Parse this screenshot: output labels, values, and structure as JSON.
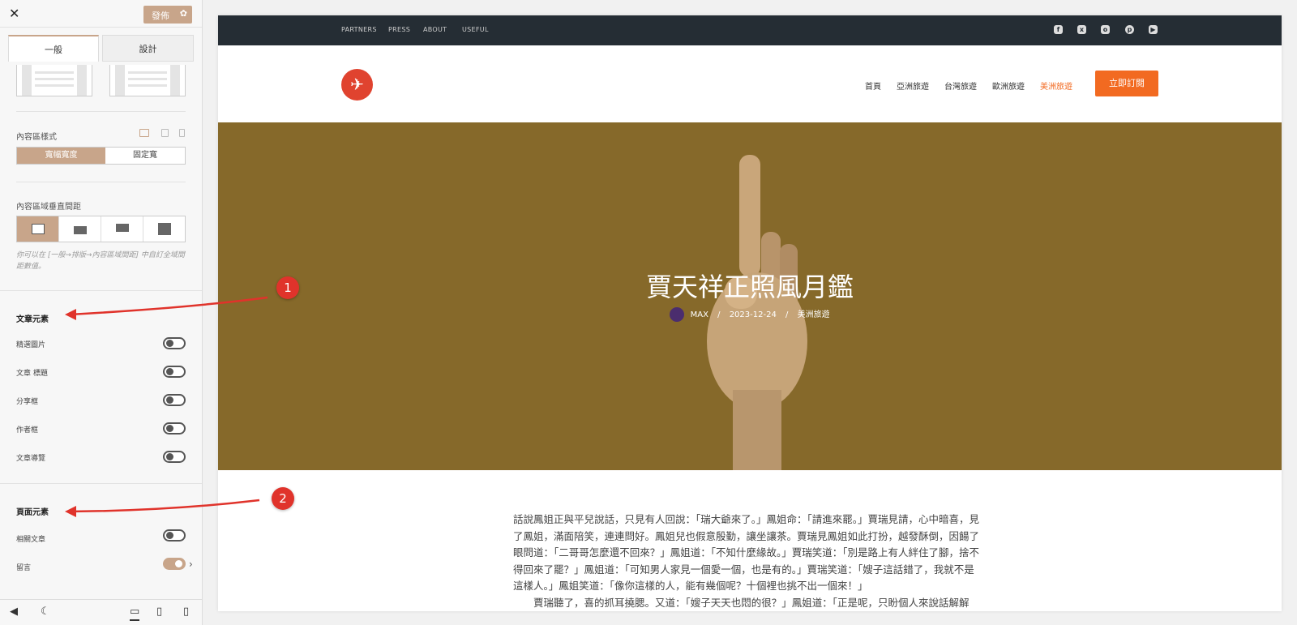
{
  "sidebar": {
    "close": "✕",
    "publish_label": "發佈",
    "tabs": [
      "一般",
      "設計"
    ],
    "content_style_label": "內容區樣式",
    "width_options": [
      "寬幅寬度",
      "固定寬"
    ],
    "spacing_label": "內容區域垂直間距",
    "spacing_note": "你可以在 [一般→排版→內容區域間距] 中自訂全域間距數值。",
    "article_section": "文章元素",
    "article_items": [
      {
        "label": "精選圖片",
        "on": false
      },
      {
        "label": "文章 標題",
        "on": false
      },
      {
        "label": "分享框",
        "on": false
      },
      {
        "label": "作者框",
        "on": false
      },
      {
        "label": "文章導覽",
        "on": false
      }
    ],
    "page_section": "頁面元素",
    "page_items": [
      {
        "label": "相關文章",
        "on": false
      },
      {
        "label": "留言",
        "on": true
      }
    ]
  },
  "preview": {
    "top_nav": [
      "PARTNERS",
      "PRESS",
      "ABOUT",
      "USEFUL"
    ],
    "social_icons": [
      "facebook-icon",
      "x-icon",
      "instagram-icon",
      "pinterest-icon",
      "youtube-icon"
    ],
    "main_nav": [
      "首頁",
      "亞洲旅遊",
      "台灣旅遊",
      "歐洲旅遊",
      "美洲旅遊"
    ],
    "cta": "立即訂閱",
    "hero_title": "賈天祥正照風月鑑",
    "author": "MAX",
    "sep": "/",
    "date": "2023-12-24",
    "category": "美洲旅遊",
    "body_text": "話說鳳姐正與平兒說話，只見有人回說：「瑞大爺來了。」鳳姐命：「請進來罷。」賈瑞見請，心中暗喜，見了鳳姐，滿面陪笑，連連問好。鳳姐兒也假意殷勤，讓坐讓茶。賈瑞見鳳姐如此打扮，越發酥倒，因餳了眼問道：「二哥哥怎麼還不回來？」鳳姐道：「不知什麼緣故。」賈瑞笑道：「別是路上有人絆住了腳，捨不得回來了罷？」鳳姐道：「可知男人家見一個愛一個，也是有的。」賈瑞笑道：「嫂子這話錯了，我就不是這樣人。」鳳姐笑道：「像你這樣的人，能有幾個呢？十個裡也挑不出一個來！」",
    "body_text2": "賈瑞聽了，喜的抓耳撓腮。又道：「嫂子天天也悶的很？」鳳姐道：「正是呢，只盼個人來說話解解"
  },
  "annotations": [
    "1",
    "2"
  ],
  "colors": {
    "accent": "#c8a58a",
    "orange": "#f26a21",
    "hero": "#86692a",
    "marker": "#e0332b"
  }
}
